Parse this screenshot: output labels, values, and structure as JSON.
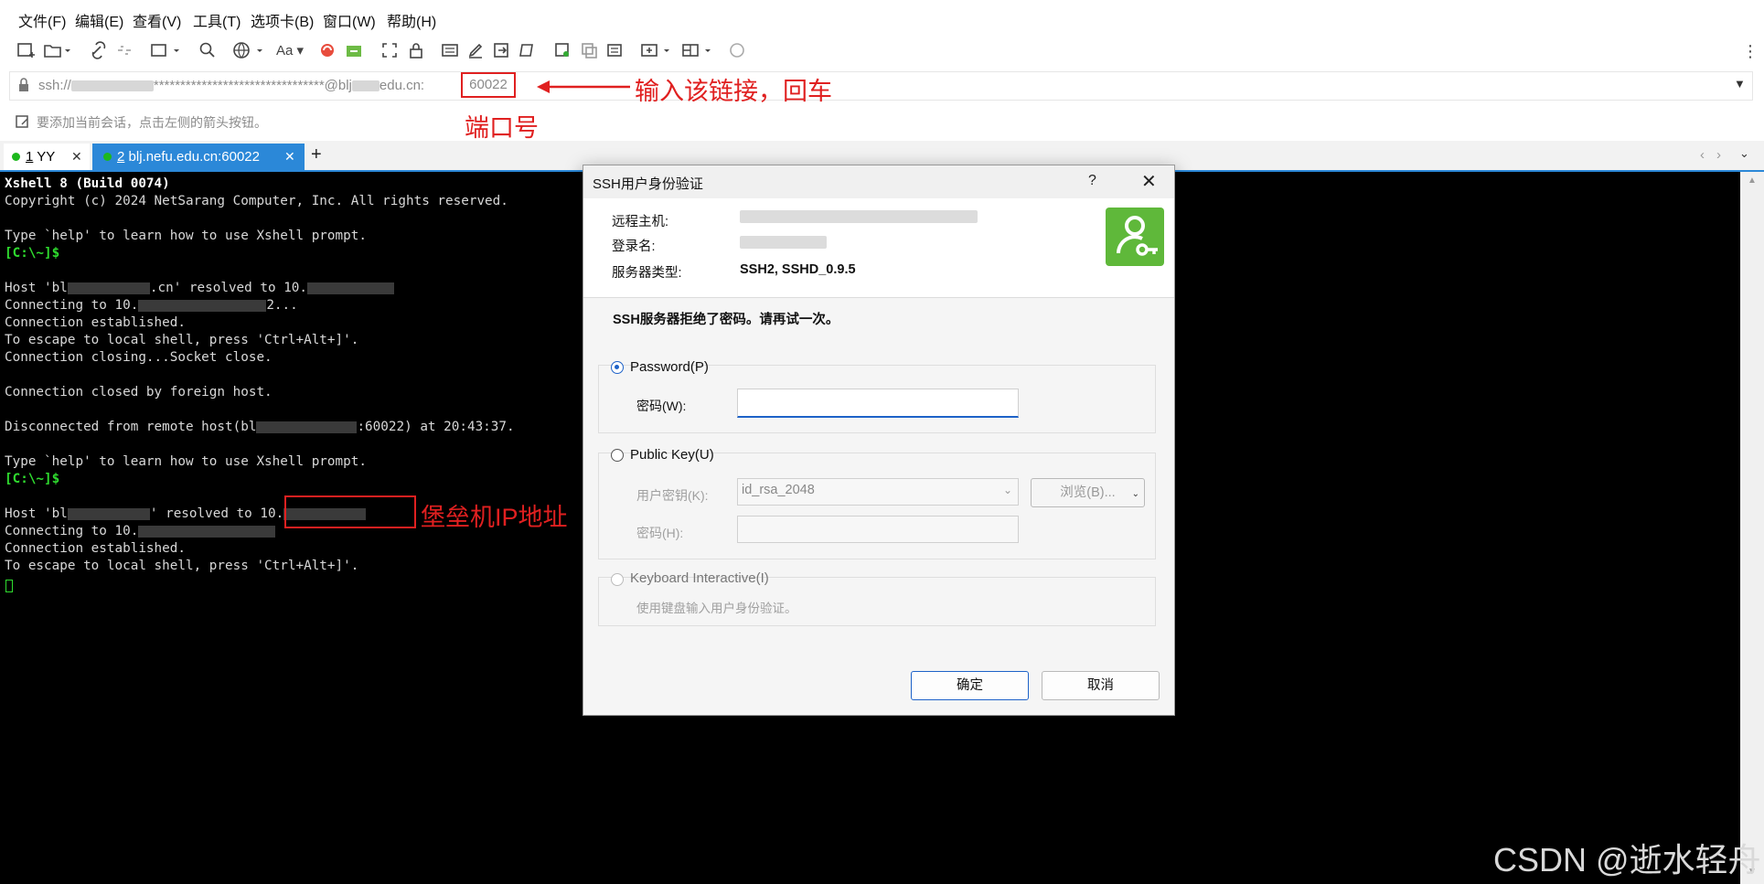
{
  "menu": [
    "文件(F)",
    "编辑(E)",
    "查看(V)",
    "工具(T)",
    "选项卡(B)",
    "窗口(W)",
    "帮助(H)"
  ],
  "address": {
    "prefix": "ssh://",
    "masked": "********************************@blj",
    "suffix": "edu.cn:",
    "port": "60022"
  },
  "hint": "要添加当前会话，点击左侧的箭头按钮。",
  "annotations": {
    "link": "输入该链接，回车",
    "port": "端口号",
    "ip": "堡垒机IP地址"
  },
  "tabs": [
    {
      "num": "1",
      "label": "YY"
    },
    {
      "num": "2",
      "label": "blj.nefu.edu.cn:60022"
    }
  ],
  "terminal": {
    "l1": "Xshell 8 (Build 0074)",
    "l2": "Copyright (c) 2024 NetSarang Computer, Inc. All rights reserved.",
    "l3": "Type `help' to learn how to use Xshell prompt.",
    "prompt": "[C:\\~]$",
    "l5a": "Host 'bl",
    "l5b": ".cn' resolved to 10.",
    "l6a": "Connecting to 10.",
    "l6b": "2...",
    "l7": "Connection established.",
    "l8": "To escape to local shell, press 'Ctrl+Alt+]'.",
    "l9": "Connection closing...Socket close.",
    "l10": "Connection closed by foreign host.",
    "l11a": "Disconnected from remote host(bl",
    "l11b": ":60022) at 20:43:37.",
    "l14a": "Host 'bl",
    "l14b": "' resolved to 10.",
    "l15": "Connecting to 10.",
    "l16": "Connection established.",
    "l17": "To escape to local shell, press 'Ctrl+Alt+]'."
  },
  "watermark": "CSDN @逝水轻舟",
  "dialog": {
    "title": "SSH用户身份验证",
    "help": "?",
    "close": "✕",
    "remote_host_label": "远程主机:",
    "login_label": "登录名:",
    "server_type_label": "服务器类型:",
    "server_type": "SSH2, SSHD_0.9.5",
    "message": "SSH服务器拒绝了密码。请再试一次。",
    "password_option": "Password(P)",
    "password_label": "密码(W):",
    "pubkey_option": "Public Key(U)",
    "user_key_label": "用户密钥(K):",
    "user_key_value": "id_rsa_2048",
    "browse": "浏览(B)...",
    "passphrase_label": "密码(H):",
    "kbd_option": "Keyboard Interactive(I)",
    "kbd_desc": "使用键盘输入用户身份验证。",
    "ok": "确定",
    "cancel": "取消"
  },
  "colors": {
    "accent": "#2b88d8",
    "annotation": "#e02020",
    "terminal_bg": "#000000",
    "prompt": "#2fdc2f"
  }
}
